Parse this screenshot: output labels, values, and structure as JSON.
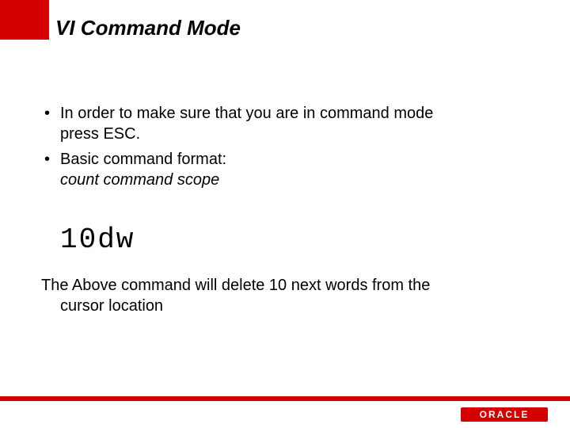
{
  "title": "VI Command Mode",
  "bullets": [
    {
      "line1": "In order to make sure that you are in command mode",
      "line2": "press ESC."
    },
    {
      "line1": "Basic command format:",
      "line2_italic": "count command scope"
    }
  ],
  "code_example": "10dw",
  "description": {
    "line1": "The Above command will delete 10 next words from the",
    "line2": "cursor location"
  },
  "logo_text": "ORACLE"
}
